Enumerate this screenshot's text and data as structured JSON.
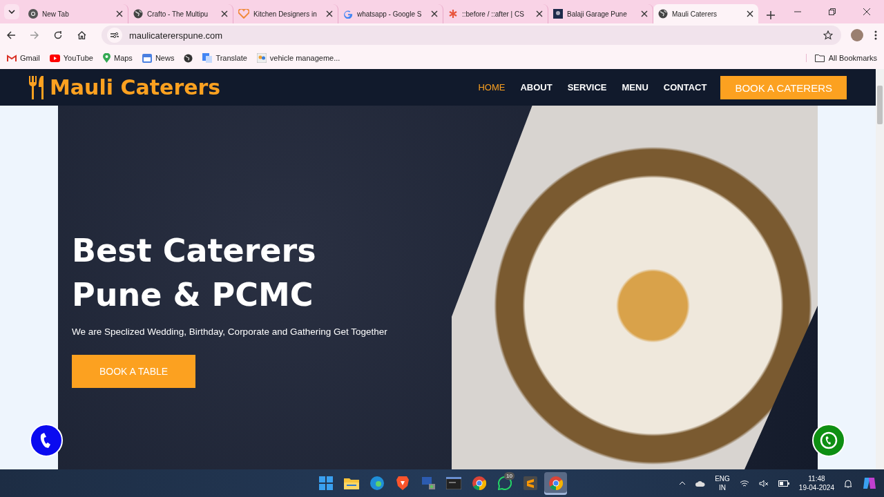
{
  "browser": {
    "tabs": [
      {
        "title": "New Tab",
        "kind": "chrome",
        "selected": false
      },
      {
        "title": "Crafto - The Multipu",
        "kind": "globe",
        "selected": false
      },
      {
        "title": "Kitchen Designers in",
        "kind": "heart",
        "selected": false
      },
      {
        "title": "whatsapp - Google S",
        "kind": "google",
        "selected": false
      },
      {
        "title": "::before / ::after | CS",
        "kind": "asterisk",
        "selected": false
      },
      {
        "title": "Balaji Garage Pune",
        "kind": "photo",
        "selected": false
      },
      {
        "title": "Mauli Caterers",
        "kind": "globe",
        "selected": true
      }
    ],
    "url": "maulicatererspune.com",
    "bookmarks": [
      {
        "label": "Gmail",
        "kind": "gmail"
      },
      {
        "label": "YouTube",
        "kind": "youtube"
      },
      {
        "label": "Maps",
        "kind": "maps"
      },
      {
        "label": "News",
        "kind": "news"
      },
      {
        "label": "Translate",
        "kind": "translate"
      },
      {
        "label": "vehicle manageme...",
        "kind": "people"
      }
    ],
    "all_bookmarks": "All Bookmarks"
  },
  "site": {
    "brand": "Mauli Caterers",
    "nav": [
      {
        "label": "HOME",
        "selected": true
      },
      {
        "label": "ABOUT",
        "selected": false
      },
      {
        "label": "SERVICE",
        "selected": false
      },
      {
        "label": "MENU",
        "selected": false
      },
      {
        "label": "CONTACT",
        "selected": false
      }
    ],
    "cta": "BOOK A CATERERS",
    "hero": {
      "title_lines": [
        "Best Caterers",
        "Pune & PCMC"
      ],
      "subtitle": "We are Speclized Wedding, Birthday, Corporate and Gathering Get Together",
      "button": "BOOK A TABLE"
    }
  },
  "taskbar": {
    "apps": [
      {
        "kind": "start",
        "selected": false
      },
      {
        "kind": "files",
        "selected": false
      },
      {
        "kind": "edge",
        "selected": false
      },
      {
        "kind": "brave",
        "selected": false
      },
      {
        "kind": "network",
        "selected": false
      },
      {
        "kind": "terminal",
        "selected": false
      },
      {
        "kind": "chrome",
        "selected": false
      },
      {
        "kind": "whatsapp",
        "selected": false,
        "badge": "10"
      },
      {
        "kind": "sublime",
        "selected": false
      },
      {
        "kind": "chrome",
        "selected": true
      }
    ],
    "language": [
      "ENG",
      "IN"
    ],
    "time": "11:48",
    "date": "19-04-2024"
  }
}
